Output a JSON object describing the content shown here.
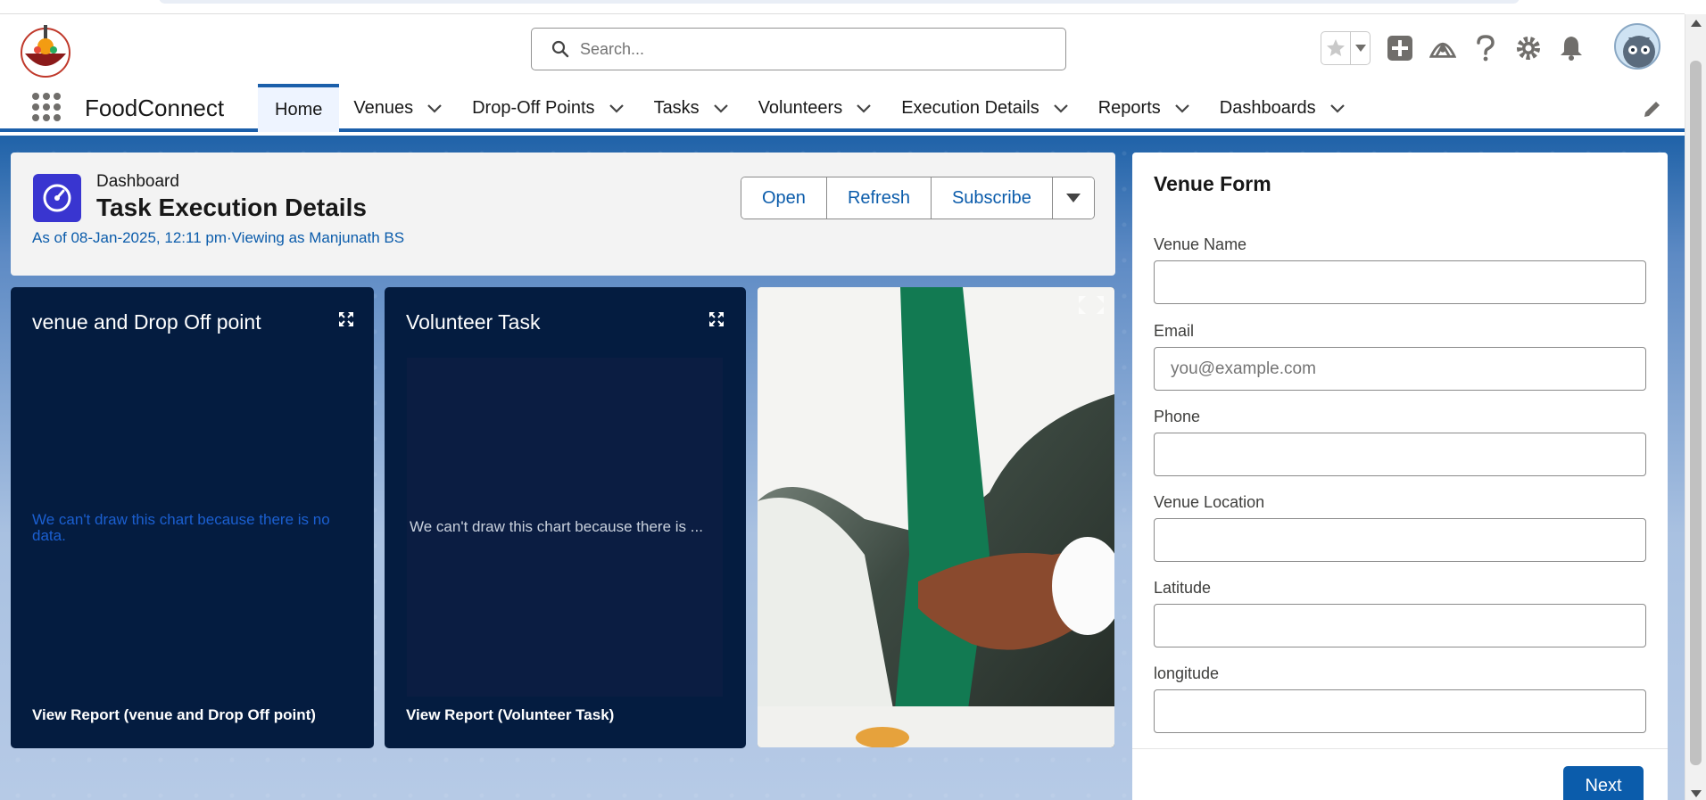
{
  "header": {
    "search_placeholder": "Search..."
  },
  "nav": {
    "app_name": "FoodConnect",
    "tabs": [
      {
        "label": "Home",
        "active": true
      },
      {
        "label": "Venues"
      },
      {
        "label": "Drop-Off Points"
      },
      {
        "label": "Tasks"
      },
      {
        "label": "Volunteers"
      },
      {
        "label": "Execution Details"
      },
      {
        "label": "Reports"
      },
      {
        "label": "Dashboards"
      }
    ]
  },
  "dashboard": {
    "kicker": "Dashboard",
    "title": "Task Execution Details",
    "meta": "As of 08-Jan-2025, 12:11 pm·Viewing as Manjunath BS",
    "buttons": {
      "open": "Open",
      "refresh": "Refresh",
      "subscribe": "Subscribe"
    }
  },
  "tiles": [
    {
      "title": "venue and Drop Off point",
      "empty_message": "We can't draw this chart because there is no data.",
      "footer": "View Report (venue and Drop Off point)"
    },
    {
      "title": "Volunteer Task",
      "empty_message": "We can't draw this chart because there is ...",
      "footer": "View Report (Volunteer Task)"
    }
  ],
  "form": {
    "title": "Venue Form",
    "fields": [
      {
        "label": "Venue Name",
        "value": "",
        "placeholder": ""
      },
      {
        "label": "Email",
        "value": "",
        "placeholder": "you@example.com"
      },
      {
        "label": "Phone",
        "value": "",
        "placeholder": ""
      },
      {
        "label": "Venue Location",
        "value": "",
        "placeholder": ""
      },
      {
        "label": "Latitude",
        "value": "",
        "placeholder": ""
      },
      {
        "label": "longitude",
        "value": "",
        "placeholder": ""
      }
    ],
    "next_label": "Next"
  },
  "icons": {
    "search": "search-icon",
    "favorite": "star-icon",
    "add": "plus-icon",
    "trailhead": "trailhead-icon",
    "help": "question-icon",
    "setup": "gear-icon",
    "notifications": "bell-icon",
    "expand": "expand-icon",
    "edit_nav": "pencil-icon"
  },
  "colors": {
    "brand_blue": "#0b5cab",
    "nav_accent": "#1b5faa",
    "tile_bg": "#041c40",
    "dashboard_icon": "#3935d0"
  }
}
